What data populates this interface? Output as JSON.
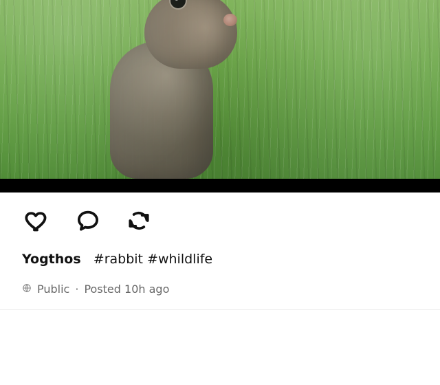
{
  "photo": {
    "subject": "rabbit-in-grass"
  },
  "actions": {
    "like_icon": "heart-icon",
    "comment_icon": "comment-icon",
    "repost_icon": "repost-icon"
  },
  "post": {
    "username": "Yogthos",
    "hashtags": "#rabbit #whildlife",
    "visibility": "Public",
    "separator": "·",
    "posted": "Posted 10h ago"
  },
  "colors": {
    "text_primary": "#111111",
    "text_secondary": "#666666",
    "bar": "#000000",
    "divider": "#eeeeee"
  }
}
